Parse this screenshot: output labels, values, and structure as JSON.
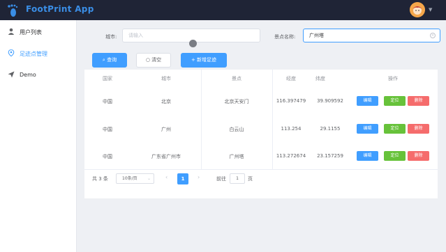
{
  "app": {
    "title": "FootPrint App"
  },
  "sidebar": {
    "items": [
      {
        "label": "用户列表",
        "icon": "user-icon"
      },
      {
        "label": "足迹点管理",
        "icon": "location-pin-icon"
      },
      {
        "label": "Demo",
        "icon": "send-icon"
      }
    ]
  },
  "filters": {
    "city_label": "城市:",
    "city_placeholder": "请输入",
    "spot_label": "景点名称:",
    "spot_value": "广州塔"
  },
  "actions": {
    "search_label": "查询",
    "clear_label": "清空",
    "add_label": "新增足迹"
  },
  "table": {
    "headers": [
      "国家",
      "城市",
      "景点",
      "经度",
      "纬度",
      "操作"
    ],
    "rows": [
      {
        "country": "中国",
        "city": "北京",
        "spot": "北京天安门",
        "lng": "116.397479",
        "lat": "39.909592"
      },
      {
        "country": "中国",
        "city": "广州",
        "spot": "白云山",
        "lng": "113.254",
        "lat": "29.1155"
      },
      {
        "country": "中国",
        "city": "广东省广州市",
        "spot": "广州塔",
        "lng": "113.272674",
        "lat": "23.157259"
      }
    ],
    "op_edit": "编辑",
    "op_locate": "定位",
    "op_delete": "删除"
  },
  "pagination": {
    "total": "共 3 条",
    "page_size": "10条/页",
    "current": "1",
    "goto_prefix": "前往",
    "goto_value": "1",
    "goto_suffix": "页"
  },
  "colors": {
    "accent": "#409eff",
    "success": "#67c23a",
    "danger": "#f56c6c",
    "topbar": "#1f2436"
  }
}
